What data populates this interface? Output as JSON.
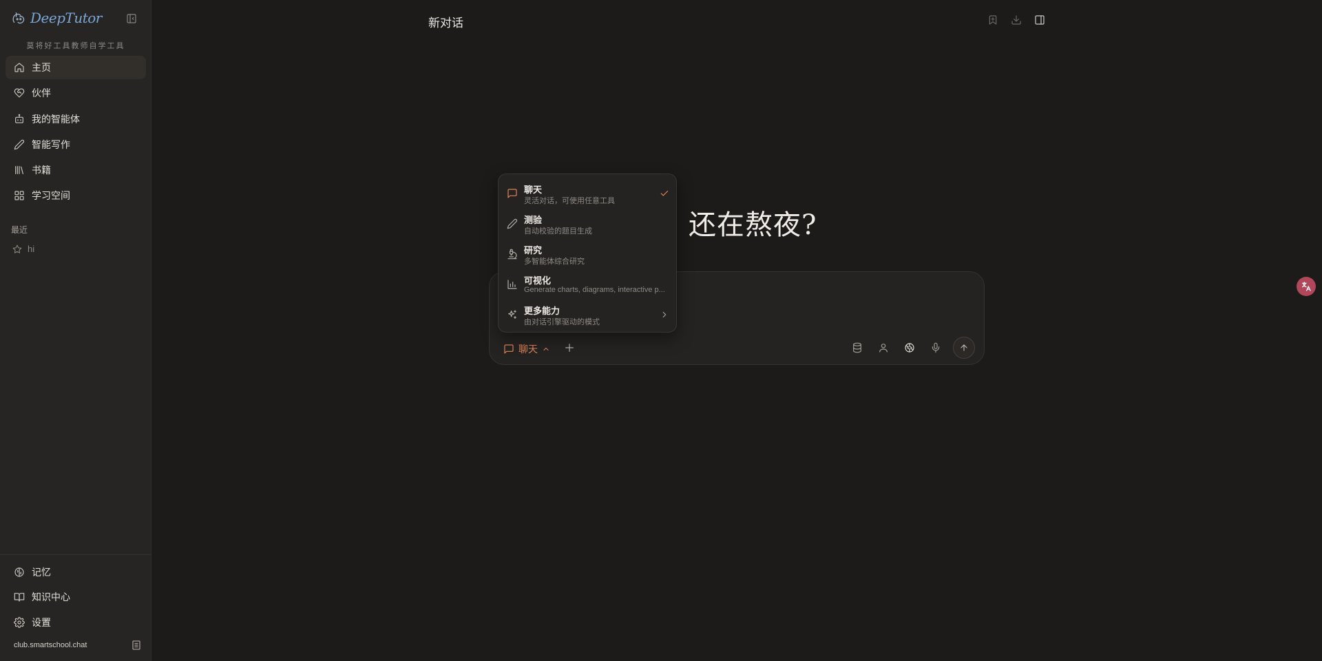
{
  "app": {
    "name": "DeepTutor",
    "slogan": "莫将好工具教师自学工具"
  },
  "sidebar": {
    "nav": [
      {
        "label": "主页",
        "icon": "home-icon",
        "active": true
      },
      {
        "label": "伙伴",
        "icon": "heart-handshake-icon",
        "active": false
      },
      {
        "label": "我的智能体",
        "icon": "bot-icon",
        "active": false
      },
      {
        "label": "智能写作",
        "icon": "pencil-icon",
        "active": false
      },
      {
        "label": "书籍",
        "icon": "library-icon",
        "active": false
      },
      {
        "label": "学习空间",
        "icon": "grid-icon",
        "active": false
      }
    ],
    "recent_label": "最近",
    "recent": [
      {
        "label": "hi",
        "icon": "star-icon"
      }
    ],
    "bottom": [
      {
        "label": "记忆",
        "icon": "brain-icon"
      },
      {
        "label": "知识中心",
        "icon": "book-open-icon"
      },
      {
        "label": "设置",
        "icon": "gear-icon"
      }
    ],
    "footer_domain": "club.smartschool.chat"
  },
  "header": {
    "title": "新对话"
  },
  "main": {
    "greeting": "还在熬夜?"
  },
  "composer": {
    "mode_label": "聊天"
  },
  "mode_menu": {
    "items": [
      {
        "title": "聊天",
        "desc": "灵活对话，可使用任意工具",
        "icon": "message-icon",
        "selected": true
      },
      {
        "title": "测验",
        "desc": "自动校验的题目生成",
        "icon": "pencil-icon",
        "selected": false
      },
      {
        "title": "研究",
        "desc": "多智能体综合研究",
        "icon": "microscope-icon",
        "selected": false
      },
      {
        "title": "可视化",
        "desc": "Generate charts, diagrams, interactive p...",
        "icon": "bar-chart-icon",
        "selected": false
      },
      {
        "title": "更多能力",
        "desc": "由对话引擎驱动的模式",
        "icon": "sparkles-icon",
        "selected": false
      }
    ]
  },
  "colors": {
    "accent": "#e08458",
    "background": "#1c1b1a",
    "sidebar": "#272523",
    "logo": "#7aa6d8"
  }
}
